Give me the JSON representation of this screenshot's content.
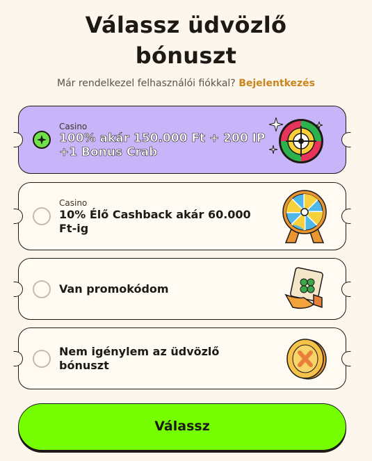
{
  "header": {
    "title_line1": "Válassz üdvözlő",
    "title_line2": "bónuszt",
    "subtitle_text": "Már rendelkezel felhasználói fiókkal?",
    "login_link": "Bejelentkezés"
  },
  "options": [
    {
      "category": "Casino",
      "line1": "100% akár 150.000 Ft + 200 IP",
      "line2": "+1 Bonus Crab",
      "selected": true,
      "icon": "roulette-wheel-icon"
    },
    {
      "category": "Casino",
      "line1": "10% Élő Cashback akár 60.000",
      "line2": "Ft-ig",
      "selected": false,
      "icon": "prize-wheel-icon"
    },
    {
      "category": "",
      "line1": "Van promokódom",
      "line2": "",
      "selected": false,
      "icon": "clover-ticket-icon"
    },
    {
      "category": "",
      "line1": "Nem igénylem az üdvözlő",
      "line2": "bónuszt",
      "selected": false,
      "icon": "x-coin-icon"
    }
  ],
  "cta": {
    "label": "Válassz"
  },
  "colors": {
    "accent_green": "#76ff02",
    "selected_purple": "#c8b4f9",
    "link_orange": "#c9841f",
    "background": "#fdf6ec"
  }
}
